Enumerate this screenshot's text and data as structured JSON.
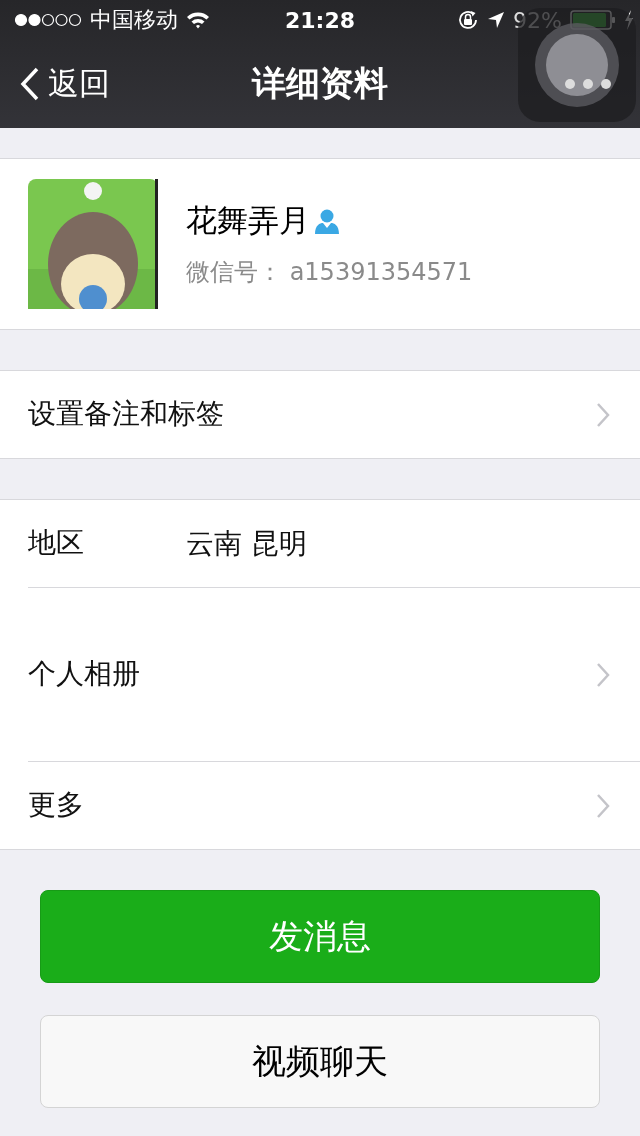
{
  "status_bar": {
    "carrier": "中国移动",
    "time": "21:28",
    "battery_percent": "92%",
    "charging": true
  },
  "nav": {
    "back": "返回",
    "title": "详细资料"
  },
  "profile": {
    "name": "花舞弄月",
    "verified": true,
    "wechat_id": "微信号： a15391354571"
  },
  "sections": [
    {
      "rows": [
        {
          "kind": "plain",
          "label": "设置备注和标签",
          "has_arrow": true
        }
      ]
    },
    {
      "rows": [
        {
          "kind": "plain",
          "label": "地区",
          "value": "云南 昆明",
          "has_arrow": false
        },
        {
          "kind": "album",
          "label": "个人相册",
          "has_arrow": true
        },
        {
          "kind": "plain",
          "label": "更多",
          "has_arrow": true
        }
      ]
    }
  ],
  "buttons": [
    {
      "kind": "primary",
      "label": "发消息"
    },
    {
      "kind": "secondary",
      "label": "视频聊天"
    }
  ]
}
